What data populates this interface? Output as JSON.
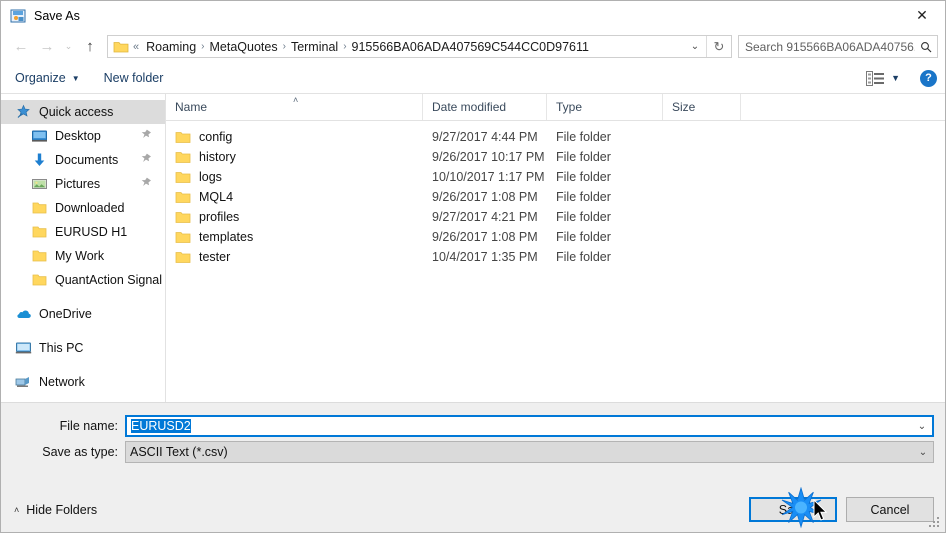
{
  "window": {
    "title": "Save As",
    "icon": "save-as-app-icon",
    "close_label": "✕"
  },
  "navigation": {
    "back_icon": "←",
    "forward_icon": "→",
    "recent_icon": "⌄",
    "up_icon": "↑",
    "refresh_icon": "↻",
    "dropdown_icon": "⌄"
  },
  "address": {
    "leading_sep": "«",
    "crumbs": [
      "Roaming",
      "MetaQuotes",
      "Terminal",
      "915566BA06ADA407569C544CC0D97611"
    ],
    "separator": "›"
  },
  "search": {
    "placeholder": "Search 915566BA06ADA40756...",
    "icon": "search-icon"
  },
  "toolbar": {
    "organize_label": "Organize",
    "organize_caret": "▼",
    "new_folder_label": "New folder",
    "view_caret": "▼",
    "help_label": "?"
  },
  "sidebar": {
    "items": [
      {
        "label": "Quick access",
        "icon": "star-pin-icon",
        "selected": true,
        "level": "root",
        "pinned": false
      },
      {
        "label": "Desktop",
        "icon": "desktop-icon",
        "selected": false,
        "level": "level1",
        "pinned": true
      },
      {
        "label": "Documents",
        "icon": "documents-icon",
        "selected": false,
        "level": "level1",
        "pinned": true
      },
      {
        "label": "Pictures",
        "icon": "pictures-icon",
        "selected": false,
        "level": "level1",
        "pinned": true
      },
      {
        "label": "Downloaded",
        "icon": "folder-icon",
        "selected": false,
        "level": "level1",
        "pinned": false
      },
      {
        "label": "EURUSD H1",
        "icon": "folder-icon",
        "selected": false,
        "level": "level1",
        "pinned": false
      },
      {
        "label": "My Work",
        "icon": "folder-icon",
        "selected": false,
        "level": "level1",
        "pinned": false
      },
      {
        "label": "QuantAction Signal",
        "icon": "folder-icon",
        "selected": false,
        "level": "level1",
        "pinned": false
      },
      {
        "label": "OneDrive",
        "icon": "onedrive-icon",
        "selected": false,
        "level": "root",
        "pinned": false,
        "gap_before": true
      },
      {
        "label": "This PC",
        "icon": "this-pc-icon",
        "selected": false,
        "level": "root",
        "pinned": false,
        "gap_before": true
      },
      {
        "label": "Network",
        "icon": "network-icon",
        "selected": false,
        "level": "root",
        "pinned": false,
        "gap_before": true
      }
    ],
    "pin_glyph": "📌"
  },
  "filelist": {
    "columns": [
      "Name",
      "Date modified",
      "Type",
      "Size"
    ],
    "sort_caret": "˄",
    "rows": [
      {
        "name": "config",
        "date": "9/27/2017 4:44 PM",
        "type": "File folder",
        "size": ""
      },
      {
        "name": "history",
        "date": "9/26/2017 10:17 PM",
        "type": "File folder",
        "size": ""
      },
      {
        "name": "logs",
        "date": "10/10/2017 1:17 PM",
        "type": "File folder",
        "size": ""
      },
      {
        "name": "MQL4",
        "date": "9/26/2017 1:08 PM",
        "type": "File folder",
        "size": ""
      },
      {
        "name": "profiles",
        "date": "9/27/2017 4:21 PM",
        "type": "File folder",
        "size": ""
      },
      {
        "name": "templates",
        "date": "9/26/2017 1:08 PM",
        "type": "File folder",
        "size": ""
      },
      {
        "name": "tester",
        "date": "10/4/2017 1:35 PM",
        "type": "File folder",
        "size": ""
      }
    ]
  },
  "form": {
    "filename_label": "File name:",
    "filename_value": "EURUSD2",
    "filetype_label": "Save as type:",
    "filetype_value": "ASCII Text (*.csv)",
    "caret": "⌄"
  },
  "footer": {
    "hide_folders_label": "Hide Folders",
    "hide_folders_caret": "˄",
    "save_label": "Save",
    "cancel_label": "Cancel"
  },
  "colors": {
    "accent": "#0078d7",
    "folder_yellow": "#ffd75e",
    "selection_blue": "#0078d7",
    "sidebar_selected": "#dcdcdc",
    "form_background": "#efefef"
  }
}
